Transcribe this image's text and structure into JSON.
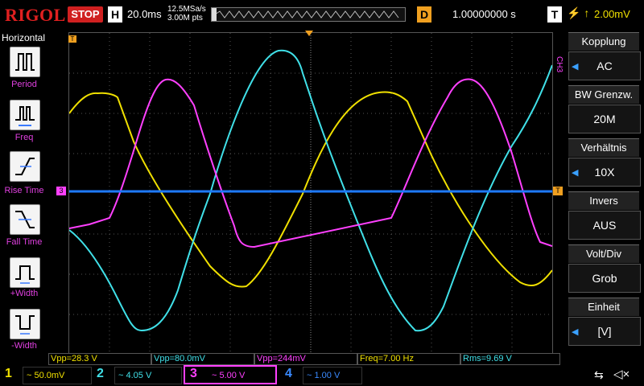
{
  "header": {
    "logo": "RIGOL",
    "run_state": "STOP",
    "timebase_label": "H",
    "timebase_value": "20.0ms",
    "sample_rate": "12.5MSa/s",
    "memory_depth": "3.00M pts",
    "delay_label": "D",
    "delay_value": "1.00000000 s",
    "trigger_label": "T",
    "trigger_symbol": "⚡ ↑",
    "trigger_level": "2.00mV"
  },
  "left_menu": {
    "title": "Horizontal",
    "items": [
      {
        "label": "Period",
        "icon": "period-icon"
      },
      {
        "label": "Freq",
        "icon": "freq-icon"
      },
      {
        "label": "Rise Time",
        "icon": "rise-time-icon"
      },
      {
        "label": "Fall Time",
        "icon": "fall-time-icon"
      },
      {
        "label": "+Width",
        "icon": "pos-width-icon"
      },
      {
        "label": "-Width",
        "icon": "neg-width-icon"
      }
    ]
  },
  "right_menu": {
    "channel_tag": "CH3",
    "items": [
      {
        "title": "Kopplung",
        "value": "AC",
        "knob": true
      },
      {
        "title": "BW Grenzw.",
        "value": "20M",
        "knob": false
      },
      {
        "title": "Verhältnis",
        "value": "10X",
        "knob": true
      },
      {
        "title": "Invers",
        "value": "AUS",
        "knob": false
      },
      {
        "title": "Volt/Div",
        "value": "Grob",
        "knob": false
      },
      {
        "title": "Einheit",
        "value": "[V]",
        "knob": true
      }
    ]
  },
  "markers": {
    "trigger_top": "T",
    "ch_left": "3",
    "trigger_right": "T"
  },
  "measurements": [
    {
      "text": "Vpp=28.3 V",
      "color": "#f0e000"
    },
    {
      "text": "Vpp=80.0mV",
      "color": "#40e0e8"
    },
    {
      "text": "Vpp=244mV",
      "color": "#ff40ff"
    },
    {
      "text": "Freq=7.00 Hz",
      "color": "#f0e000"
    },
    {
      "text": "Rms=9.69 V",
      "color": "#40e0e8"
    }
  ],
  "channels": [
    {
      "num": "1",
      "scale": "~ 50.0mV",
      "color": "#f0e000",
      "active": false
    },
    {
      "num": "2",
      "scale": "~ 4.05 V",
      "color": "#40e0e8",
      "active": false
    },
    {
      "num": "3",
      "scale": "~ 5.00 V",
      "color": "#ff40ff",
      "active": true
    },
    {
      "num": "4",
      "scale": "~ 1.00 V",
      "color": "#3a8aff",
      "active": false
    }
  ],
  "status_icons": [
    "usb-icon",
    "speaker-muted-icon"
  ],
  "colors": {
    "ch1": "#f0e000",
    "ch2": "#40e0e8",
    "ch3": "#ff40ff",
    "ch4": "#1e7aff",
    "trigger": "#f0a020"
  }
}
